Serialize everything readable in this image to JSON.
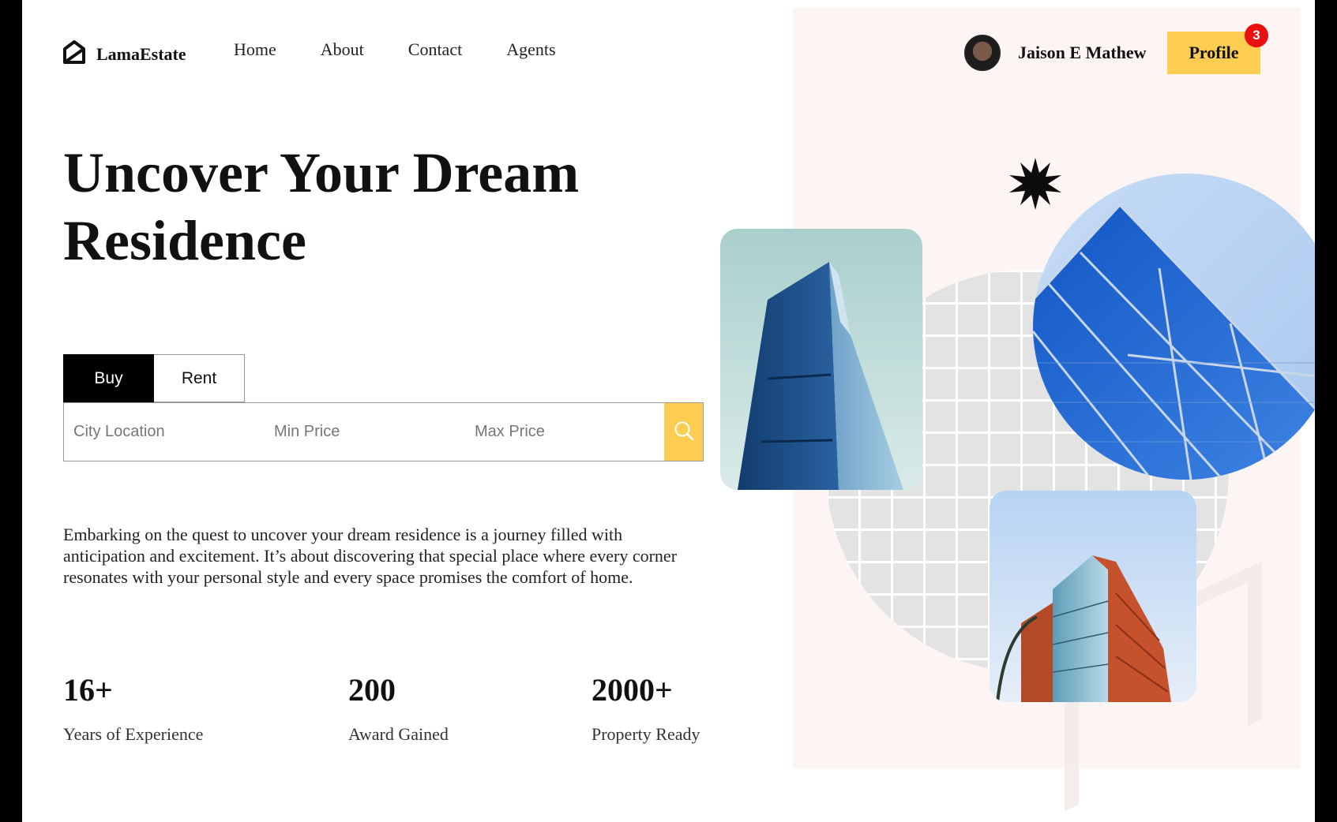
{
  "brand": {
    "name": "LamaEstate"
  },
  "nav": {
    "items": [
      "Home",
      "About",
      "Contact",
      "Agents"
    ]
  },
  "user": {
    "name": "Jaison E Mathew",
    "profile_label": "Profile",
    "notification_count": "3"
  },
  "hero": {
    "title": "Uncover Your Dream Residence",
    "tabs": [
      "Buy",
      "Rent"
    ],
    "active_tab": "Buy",
    "search": {
      "location_placeholder": "City Location",
      "min_price_placeholder": "Min Price",
      "max_price_placeholder": "Max Price",
      "button_icon": "search-icon"
    },
    "description": "Embarking on the quest to uncover your dream residence is a journey filled with anticipation and excitement. It’s about discovering that special place where every corner resonates with your personal style and every space promises the comfort of home."
  },
  "stats": [
    {
      "value": "16+",
      "label": "Years of Experience"
    },
    {
      "value": "200",
      "label": "Award Gained"
    },
    {
      "value": "2000+",
      "label": "Property Ready"
    }
  ],
  "colors": {
    "accent": "#fecd51",
    "badge": "#e81010",
    "panel_bg": "#fcf5f3",
    "tab_active": "#000000"
  }
}
